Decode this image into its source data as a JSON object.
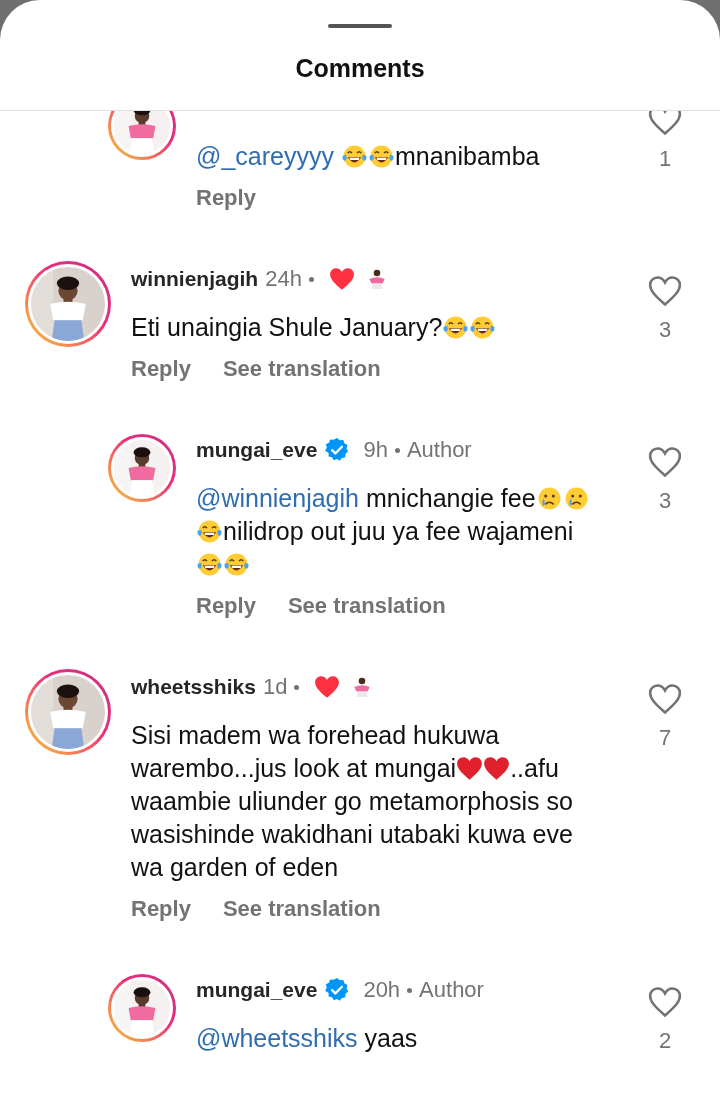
{
  "sheet": {
    "title": "Comments"
  },
  "comments": [
    {
      "kind": "reply",
      "body": [
        {
          "kind": "mention",
          "text": "@_careyyyy"
        },
        {
          "kind": "laughing"
        },
        {
          "kind": "laughing"
        },
        {
          "kind": "text",
          "text": "mnanibamba"
        }
      ],
      "actions": [
        "Reply"
      ],
      "likes": "1"
    },
    {
      "kind": "comment",
      "user": "winnienjagih",
      "time": "24h",
      "verified": false,
      "liked_by_author": true,
      "body": [
        {
          "kind": "text",
          "text": "Eti unaingia Shule January?"
        },
        {
          "kind": "laughing"
        },
        {
          "kind": "laughing"
        }
      ],
      "actions": [
        "Reply",
        "See translation"
      ],
      "likes": "3"
    },
    {
      "kind": "reply",
      "user": "mungai_eve",
      "time": "9h",
      "role": "Author",
      "verified": true,
      "liked_by_author": false,
      "body": [
        {
          "kind": "mention",
          "text": "@winnienjagih"
        },
        {
          "kind": "text",
          "text": "mnichangie fee"
        },
        {
          "kind": "crying"
        },
        {
          "kind": "crying"
        },
        {
          "kind": "laughing"
        },
        {
          "kind": "text",
          "text": "nilidrop out juu ya fee wajameni"
        },
        {
          "kind": "laughing"
        },
        {
          "kind": "laughing"
        }
      ],
      "actions": [
        "Reply",
        "See translation"
      ],
      "likes": "3"
    },
    {
      "kind": "comment",
      "user": "wheetsshiks",
      "time": "1d",
      "verified": false,
      "liked_by_author": true,
      "body": [
        {
          "kind": "text",
          "text": "Sisi madem wa forehead hukuwa warembo...jus look at mungai"
        },
        {
          "kind": "heart"
        },
        {
          "kind": "heart"
        },
        {
          "kind": "text",
          "text": "..afu waambie uliunder go metamorphosis so wasishinde wakidhani utabaki kuwa eve wa garden of eden"
        }
      ],
      "actions": [
        "Reply",
        "See translation"
      ],
      "likes": "7"
    },
    {
      "kind": "reply",
      "user": "mungai_eve",
      "time": "20h",
      "role": "Author",
      "verified": true,
      "liked_by_author": false,
      "body": [
        {
          "kind": "mention",
          "text": "@wheetsshiks"
        },
        {
          "kind": "text",
          "text": "yaas"
        }
      ],
      "likes": "2"
    }
  ]
}
